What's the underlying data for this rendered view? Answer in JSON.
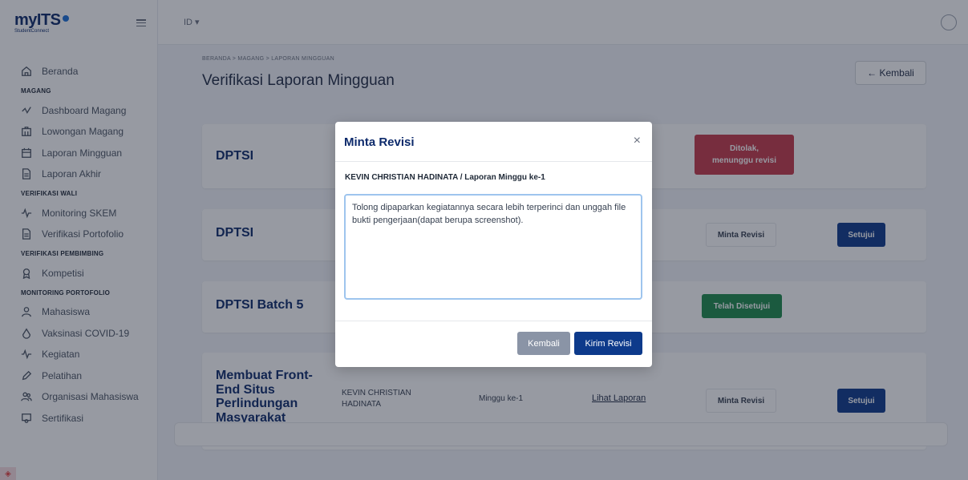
{
  "app": {
    "logo_text": "myITS",
    "logo_sub": "StudentConnect"
  },
  "topbar": {
    "lang": "ID ▾"
  },
  "sidebar": {
    "items": [
      {
        "label": "Beranda",
        "icon": "home-icon"
      },
      {
        "section": "MAGANG"
      },
      {
        "label": "Dashboard Magang",
        "icon": "activity-icon"
      },
      {
        "label": "Lowongan Magang",
        "icon": "building-icon"
      },
      {
        "label": "Laporan Mingguan",
        "icon": "calendar-icon"
      },
      {
        "label": "Laporan Akhir",
        "icon": "document-icon"
      },
      {
        "section": "VERIFIKASI WALI"
      },
      {
        "label": "Monitoring SKEM",
        "icon": "pulse-icon"
      },
      {
        "label": "Verifikasi Portofolio",
        "icon": "document-icon"
      },
      {
        "section": "VERIFIKASI PEMBIMBING"
      },
      {
        "label": "Kompetisi",
        "icon": "award-icon"
      },
      {
        "section": "MONITORING PORTOFOLIO"
      },
      {
        "label": "Mahasiswa",
        "icon": "user-icon"
      },
      {
        "label": "Vaksinasi COVID-19",
        "icon": "drop-icon"
      },
      {
        "label": "Kegiatan",
        "icon": "pulse-icon"
      },
      {
        "label": "Pelatihan",
        "icon": "pen-icon"
      },
      {
        "label": "Organisasi Mahasiswa",
        "icon": "users-icon"
      },
      {
        "label": "Sertifikasi",
        "icon": "certificate-icon"
      }
    ]
  },
  "page": {
    "breadcrumb": "BERANDA  >  MAGANG  >  LAPORAN MINGGUAN",
    "title": "Verifikasi Laporan Mingguan",
    "back_label": "← Kembali"
  },
  "cards": [
    {
      "title": "DPTSI",
      "status": "Ditolak, menunggu revisi",
      "status_color": "#c53a4a"
    },
    {
      "title": "DPTSI",
      "revise_label": "Minta Revisi",
      "approve_label": "Setujui"
    },
    {
      "title": "DPTSI Batch 5",
      "status": "Telah Disetujui",
      "status_color": "#1e8a4c"
    },
    {
      "title": "Membuat Front-End Situs Perlindungan Masyarakat",
      "title_lines": [
        "Membuat Front-",
        "End Situs",
        "Perlindungan",
        "Masyarakat"
      ],
      "student_lines": [
        "KEVIN CHRISTIAN",
        "HADINATA"
      ],
      "week": "Minggu ke-1",
      "report_link": "Lihat Laporan",
      "revise_label": "Minta Revisi",
      "approve_label": "Setujui"
    }
  ],
  "modal": {
    "title": "Minta Revisi",
    "close": "×",
    "subtitle": "KEVIN CHRISTIAN HADINATA / Laporan Minggu ke-1",
    "message": "Tolong dipaparkan kegiatannya secara lebih terperinci dan unggah file bukti pengerjaan(dapat berupa screenshot).",
    "cancel_label": "Kembali",
    "submit_label": "Kirim Revisi"
  },
  "colors": {
    "primary": "#0d3a8b",
    "danger": "#c53a4a",
    "success": "#1e8a4c",
    "secondary": "#8a94a6"
  }
}
